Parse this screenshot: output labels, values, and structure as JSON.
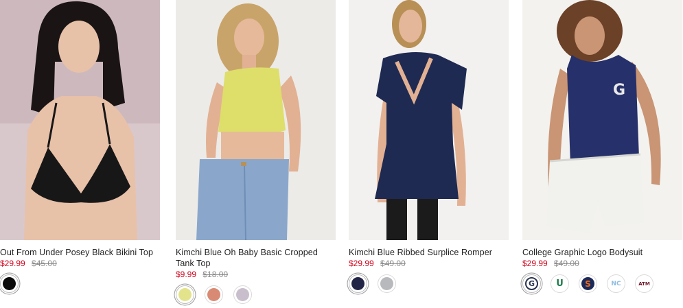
{
  "products": [
    {
      "name": "Kimchi Blue Oh Baby Basic Cropped Tank Top",
      "sale_price": "$9.99",
      "original_price": "$18.00",
      "swatches": [
        {
          "name": "lime",
          "color": "#e3e38c"
        },
        {
          "name": "coral",
          "color": "#d98a74"
        },
        {
          "name": "lilac",
          "color": "#c9bfcc"
        }
      ]
    },
    {
      "name": "Kimchi Blue Ribbed Surplice Romper",
      "sale_price": "$29.99",
      "original_price": "$49.00",
      "swatches": [
        {
          "name": "navy",
          "color": "#232547"
        },
        {
          "name": "grey",
          "color": "#b8b9bc"
        }
      ]
    },
    {
      "name": "College Graphic Logo Bodysuit",
      "sale_price": "$29.99",
      "original_price": "$49.00",
      "swatches": [
        {
          "name": "georgetown-logo",
          "color": "#2a3350",
          "icon": "G"
        },
        {
          "name": "miami-logo",
          "color": "#1f7a4a",
          "icon": "U"
        },
        {
          "name": "syracuse-logo",
          "color": "#e86a1c",
          "icon": "S"
        },
        {
          "name": "north-carolina-logo",
          "color": "#8fbbe0",
          "icon": "NC"
        },
        {
          "name": "texas-am-logo",
          "color": "#6e1a2a",
          "icon": "ATM"
        }
      ]
    },
    {
      "name": "Out From Under Posey Black Bikini Top",
      "sale_price": "$29.99",
      "original_price": "$45.00",
      "swatches": [
        {
          "name": "black",
          "color": "#0a0a0a"
        }
      ]
    }
  ]
}
